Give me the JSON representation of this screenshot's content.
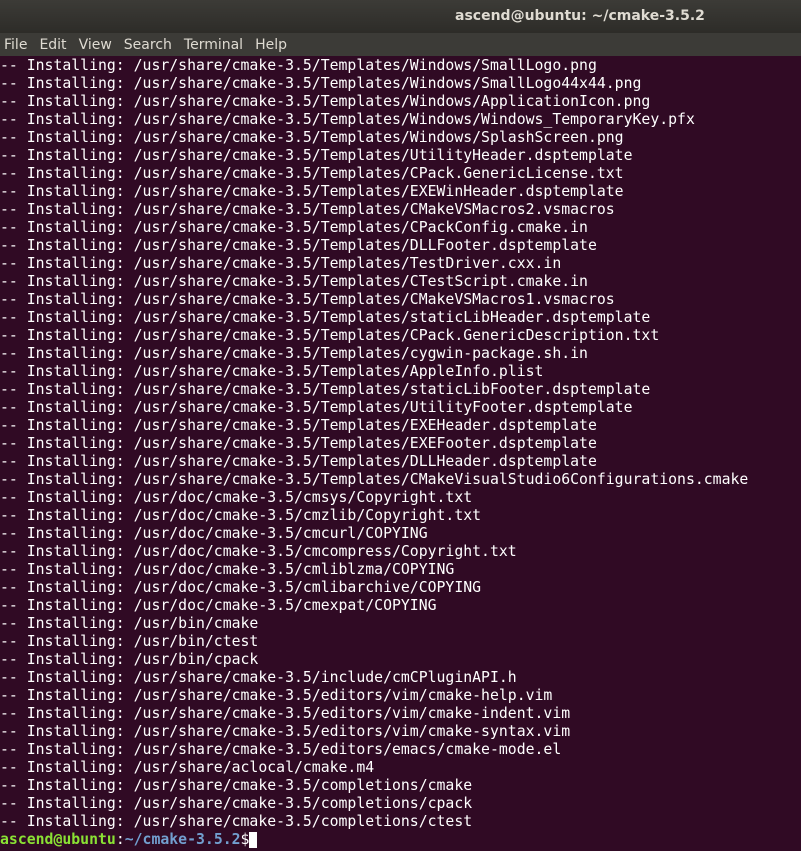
{
  "window": {
    "title": "ascend@ubuntu: ~/cmake-3.5.2"
  },
  "menu": [
    "File",
    "Edit",
    "View",
    "Search",
    "Terminal",
    "Help"
  ],
  "lines": [
    "-- Installing: /usr/share/cmake-3.5/Templates/Windows/SmallLogo.png",
    "-- Installing: /usr/share/cmake-3.5/Templates/Windows/SmallLogo44x44.png",
    "-- Installing: /usr/share/cmake-3.5/Templates/Windows/ApplicationIcon.png",
    "-- Installing: /usr/share/cmake-3.5/Templates/Windows/Windows_TemporaryKey.pfx",
    "-- Installing: /usr/share/cmake-3.5/Templates/Windows/SplashScreen.png",
    "-- Installing: /usr/share/cmake-3.5/Templates/UtilityHeader.dsptemplate",
    "-- Installing: /usr/share/cmake-3.5/Templates/CPack.GenericLicense.txt",
    "-- Installing: /usr/share/cmake-3.5/Templates/EXEWinHeader.dsptemplate",
    "-- Installing: /usr/share/cmake-3.5/Templates/CMakeVSMacros2.vsmacros",
    "-- Installing: /usr/share/cmake-3.5/Templates/CPackConfig.cmake.in",
    "-- Installing: /usr/share/cmake-3.5/Templates/DLLFooter.dsptemplate",
    "-- Installing: /usr/share/cmake-3.5/Templates/TestDriver.cxx.in",
    "-- Installing: /usr/share/cmake-3.5/Templates/CTestScript.cmake.in",
    "-- Installing: /usr/share/cmake-3.5/Templates/CMakeVSMacros1.vsmacros",
    "-- Installing: /usr/share/cmake-3.5/Templates/staticLibHeader.dsptemplate",
    "-- Installing: /usr/share/cmake-3.5/Templates/CPack.GenericDescription.txt",
    "-- Installing: /usr/share/cmake-3.5/Templates/cygwin-package.sh.in",
    "-- Installing: /usr/share/cmake-3.5/Templates/AppleInfo.plist",
    "-- Installing: /usr/share/cmake-3.5/Templates/staticLibFooter.dsptemplate",
    "-- Installing: /usr/share/cmake-3.5/Templates/UtilityFooter.dsptemplate",
    "-- Installing: /usr/share/cmake-3.5/Templates/EXEHeader.dsptemplate",
    "-- Installing: /usr/share/cmake-3.5/Templates/EXEFooter.dsptemplate",
    "-- Installing: /usr/share/cmake-3.5/Templates/DLLHeader.dsptemplate",
    "-- Installing: /usr/share/cmake-3.5/Templates/CMakeVisualStudio6Configurations.cmake",
    "-- Installing: /usr/doc/cmake-3.5/cmsys/Copyright.txt",
    "-- Installing: /usr/doc/cmake-3.5/cmzlib/Copyright.txt",
    "-- Installing: /usr/doc/cmake-3.5/cmcurl/COPYING",
    "-- Installing: /usr/doc/cmake-3.5/cmcompress/Copyright.txt",
    "-- Installing: /usr/doc/cmake-3.5/cmliblzma/COPYING",
    "-- Installing: /usr/doc/cmake-3.5/cmlibarchive/COPYING",
    "-- Installing: /usr/doc/cmake-3.5/cmexpat/COPYING",
    "-- Installing: /usr/bin/cmake",
    "-- Installing: /usr/bin/ctest",
    "-- Installing: /usr/bin/cpack",
    "-- Installing: /usr/share/cmake-3.5/include/cmCPluginAPI.h",
    "-- Installing: /usr/share/cmake-3.5/editors/vim/cmake-help.vim",
    "-- Installing: /usr/share/cmake-3.5/editors/vim/cmake-indent.vim",
    "-- Installing: /usr/share/cmake-3.5/editors/vim/cmake-syntax.vim",
    "-- Installing: /usr/share/cmake-3.5/editors/emacs/cmake-mode.el",
    "-- Installing: /usr/share/aclocal/cmake.m4",
    "-- Installing: /usr/share/cmake-3.5/completions/cmake",
    "-- Installing: /usr/share/cmake-3.5/completions/cpack",
    "-- Installing: /usr/share/cmake-3.5/completions/ctest"
  ],
  "prompt": {
    "user_host": "ascend@ubuntu",
    "separator": ":",
    "path": "~/cmake-3.5.2",
    "symbol": "$"
  },
  "colors": {
    "background": "#300a24",
    "text": "#ffffff",
    "prompt_user": "#8ae234",
    "prompt_path": "#729fcf"
  }
}
